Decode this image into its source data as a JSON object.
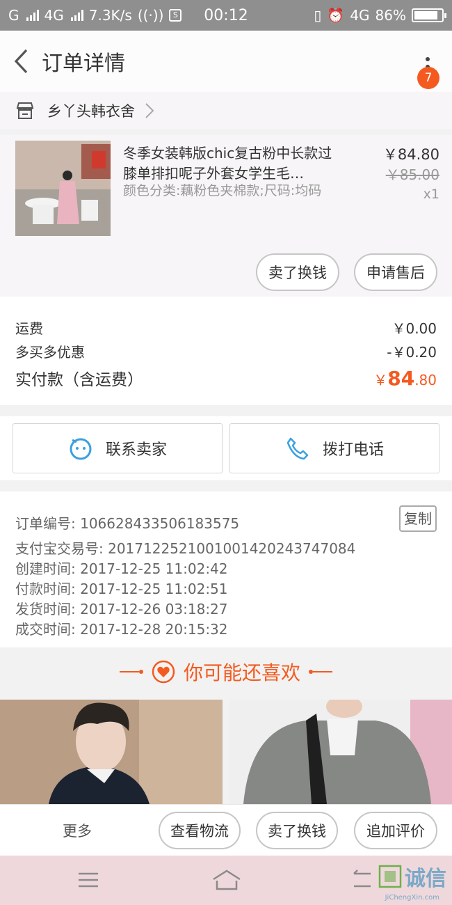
{
  "status_bar": {
    "carrier_left": "G",
    "network": "4G",
    "speed": "7.3K/s",
    "time": "00:12",
    "network_right": "4G",
    "battery": "86%",
    "battery_level": 0.86
  },
  "nav": {
    "title": "订单详情",
    "badge_count": "7"
  },
  "shop": {
    "name": "乡丫头韩衣舍"
  },
  "product": {
    "title": "冬季女装韩版chic复古粉中长款过膝单排扣呢子外套女学生毛…",
    "sku": "颜色分类:藕粉色夹棉款;尺码:均码",
    "price": "￥84.80",
    "original_price": "￥85.00",
    "quantity": "x1",
    "actions": {
      "sell": "卖了换钱",
      "after_sale": "申请售后"
    }
  },
  "fees": {
    "shipping_label": "运费",
    "shipping_value": "￥0.00",
    "discount_label": "多买多优惠",
    "discount_value": "-￥0.20",
    "total_label": "实付款（含运费）",
    "total_currency": "￥",
    "total_int": "84",
    "total_dec": ".80"
  },
  "contact": {
    "seller": "联系卖家",
    "phone": "拨打电话"
  },
  "order_info": {
    "order_no": "订单编号: 106628433506183575",
    "alipay_no": "支付宝交易号: 2017122521001001420243747084",
    "created": "创建时间: 2017-12-25 11:02:42",
    "paid": "付款时间: 2017-12-25 11:02:51",
    "shipped": "发货时间: 2017-12-26 03:18:27",
    "completed": "成交时间: 2017-12-28 20:15:32",
    "copy": "复制"
  },
  "recommend": {
    "title": "你可能还喜欢"
  },
  "bottom_bar": {
    "more": "更多",
    "logistics": "查看物流",
    "sell": "卖了换钱",
    "review": "追加评价"
  },
  "watermark": {
    "text": "诚信",
    "sub": "JiChengXin.com"
  },
  "colors": {
    "accent": "#f45a1f",
    "icon_blue": "#3aa0e0"
  }
}
